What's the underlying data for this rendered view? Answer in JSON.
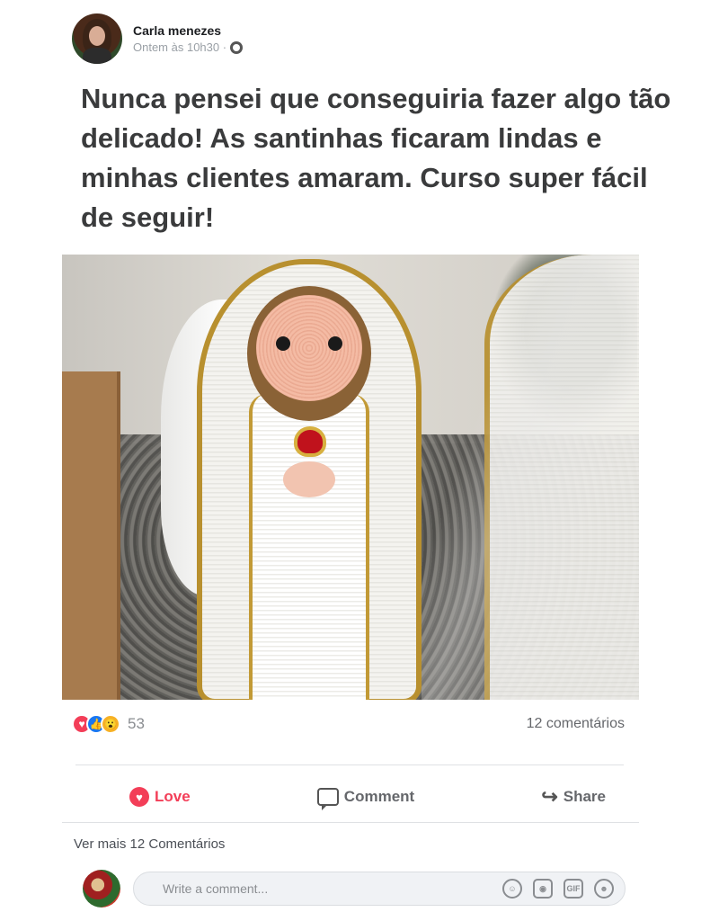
{
  "post": {
    "author": "Carla menezes",
    "timestamp": "Ontem às 10h30 ·",
    "text": "Nunca pensei que conseguiria fazer algo tão delicado! As santinhas ficaram lindas e minhas clientes amaram. Curso super fácil de seguir!"
  },
  "reactions": {
    "icons": [
      "love-icon",
      "like-icon",
      "wow-icon"
    ],
    "count": "53",
    "comments": "12 comentários"
  },
  "actions": {
    "love": "Love",
    "comment": "Comment",
    "share": "Share"
  },
  "see_more": "Ver mais 12 Comentários",
  "composer": {
    "placeholder": "Write a comment...",
    "tools": [
      "emoji-icon",
      "camera-icon",
      "gif-icon",
      "sticker-icon"
    ],
    "gif_label": "GIF"
  },
  "colors": {
    "love": "#f33e58",
    "like": "#1877f2",
    "wow": "#f7b125"
  }
}
